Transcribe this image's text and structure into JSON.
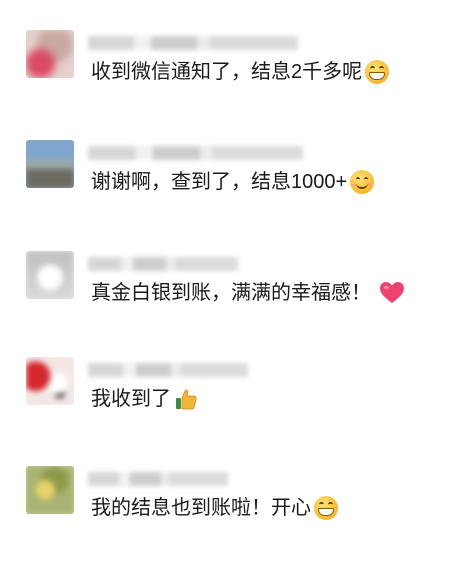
{
  "comments": [
    {
      "text": "收到微信通知了，结息2千多呢",
      "emoji": "grin-icon"
    },
    {
      "text": "谢谢啊，查到了，结息1000+",
      "emoji": "smile-icon"
    },
    {
      "text": "真金白银到账，满满的幸福感！",
      "emoji": "heart-icon"
    },
    {
      "text": "我收到了",
      "emoji": "thumbs-up-icon"
    },
    {
      "text": "我的结息也到账啦！开心",
      "emoji": "grin-icon"
    }
  ],
  "colors": {
    "text": "#1a1a1a",
    "heart": "#f0426e",
    "emoji_yellow": "#f7b82a",
    "thumb": "#f5b637"
  }
}
